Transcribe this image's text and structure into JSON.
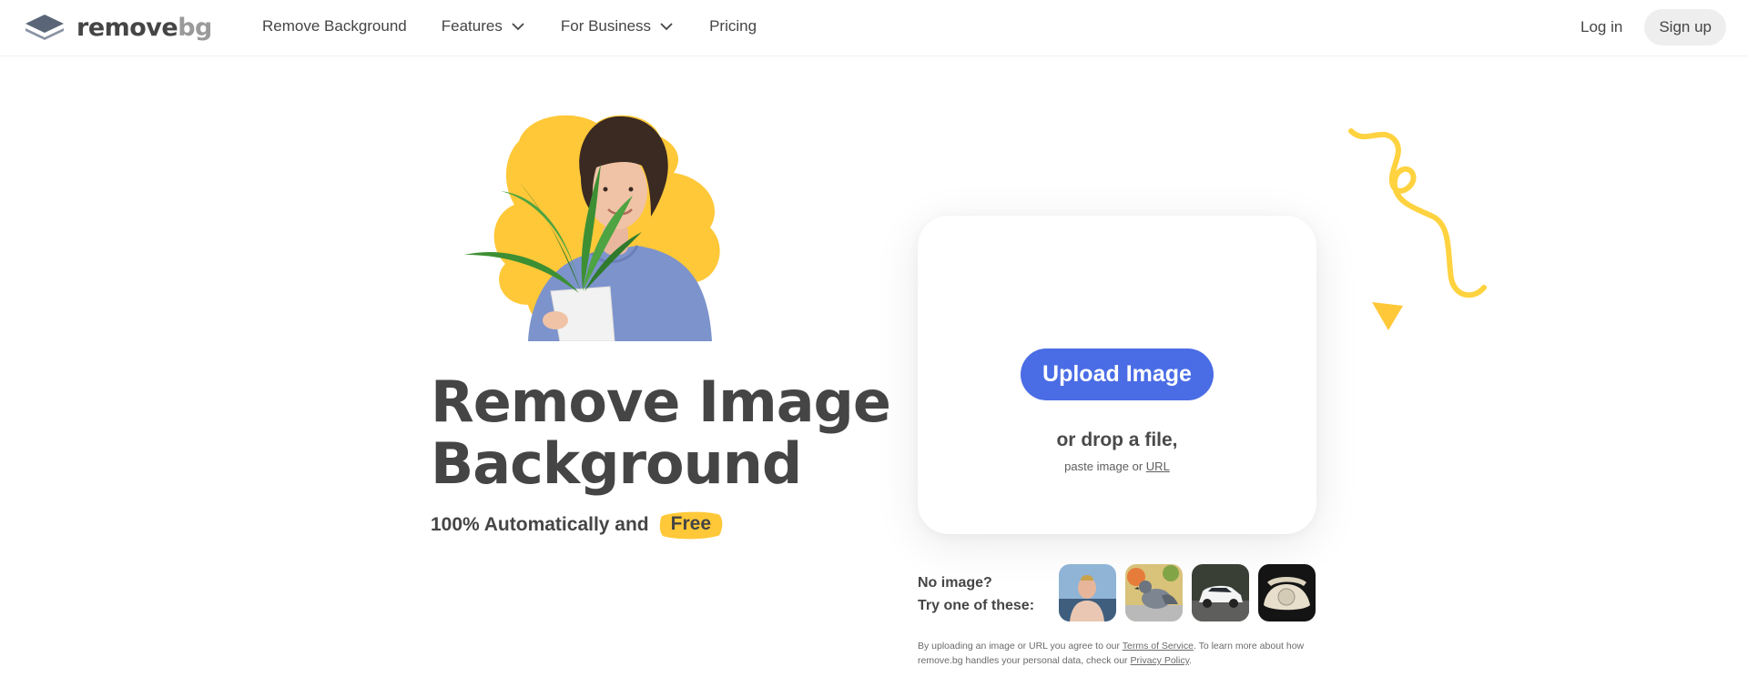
{
  "nav": {
    "logo_word": "remove",
    "logo_bg": "bg",
    "links": [
      {
        "label": "Remove Background",
        "dropdown": false
      },
      {
        "label": "Features",
        "dropdown": true
      },
      {
        "label": "For Business",
        "dropdown": true
      },
      {
        "label": "Pricing",
        "dropdown": false
      }
    ],
    "login": "Log in",
    "signup": "Sign up"
  },
  "hero": {
    "title_line1": "Remove Image",
    "title_line2": "Background",
    "subtitle": "100% Automatically and",
    "free_badge": "Free"
  },
  "upload": {
    "button": "Upload Image",
    "drop_text": "or drop a file,",
    "paste_text": "paste image or",
    "url_link": "URL"
  },
  "samples": {
    "line1": "No image?",
    "line2": "Try one of these:",
    "thumbs": [
      "person-sample",
      "pigeon-sample",
      "car-sample",
      "phone-sample"
    ]
  },
  "legal": {
    "part1": "By uploading an image or URL you agree to our",
    "tos": "Terms of Service",
    "part2": ". To learn more about how remove.bg handles your personal data, check our",
    "privacy": "Privacy Policy",
    "part3": "."
  },
  "colors": {
    "accent_blue": "#4a6ce5",
    "accent_yellow": "#ffc838",
    "text": "#454545"
  }
}
